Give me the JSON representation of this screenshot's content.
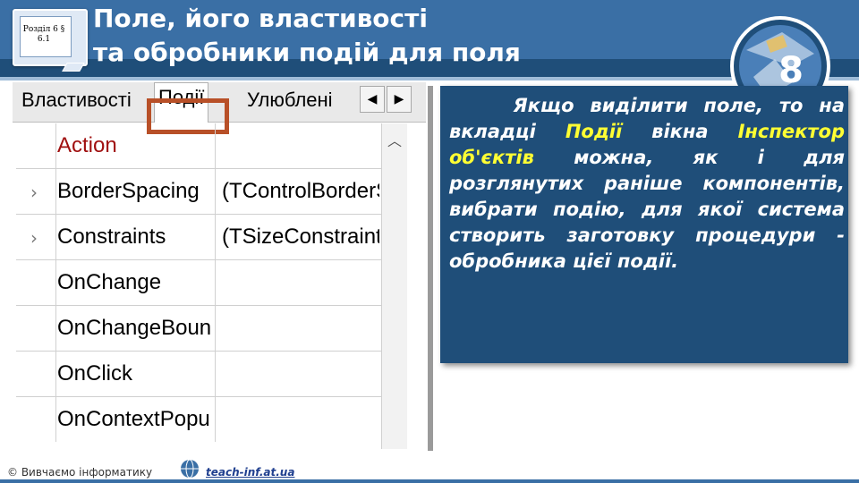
{
  "header": {
    "title_line1": "Поле, його властивості",
    "title_line2": "та обробники подій для поля",
    "section_line1": "Розділ 6 §",
    "section_line2": "6.1",
    "grade_number": "8"
  },
  "inspector": {
    "tabs": [
      {
        "label": "Властивості"
      },
      {
        "label": "Події"
      },
      {
        "label": "Улюблені"
      }
    ],
    "nav_left": "◀",
    "nav_right": "▶",
    "rows": [
      {
        "name": "Action",
        "value": "",
        "expandable": false,
        "name_color": "#a01010"
      },
      {
        "name": "BorderSpacing",
        "value": "(TControlBorderS",
        "expandable": true
      },
      {
        "name": "Constraints",
        "value": "(TSizeConstraints",
        "expandable": true
      },
      {
        "name": "OnChange",
        "value": "",
        "expandable": false
      },
      {
        "name": "OnChangeBoun",
        "value": "",
        "expandable": false
      },
      {
        "name": "OnClick",
        "value": "",
        "expandable": false
      },
      {
        "name": "OnContextPopu",
        "value": "",
        "expandable": false
      }
    ]
  },
  "explanation": {
    "part1": "Якщо виділити поле, то на вкладці ",
    "highlight1": "Події",
    "part2": " вікна ",
    "highlight2": "Інспектор об'єктів",
    "part3": " можна, як і для розглянутих раніше компонентів, вибрати подію, для якої система створить заготовку процедури - обробника цієї події."
  },
  "footer": {
    "copyright": "© Вивчаємо інформатику",
    "link": "teach-inf.at.ua"
  },
  "colors": {
    "header_blue": "#3a6fa5",
    "dark_blue": "#1f4e79",
    "highlight_yellow": "#ffff33",
    "tab_highlight_border": "#b85028"
  }
}
